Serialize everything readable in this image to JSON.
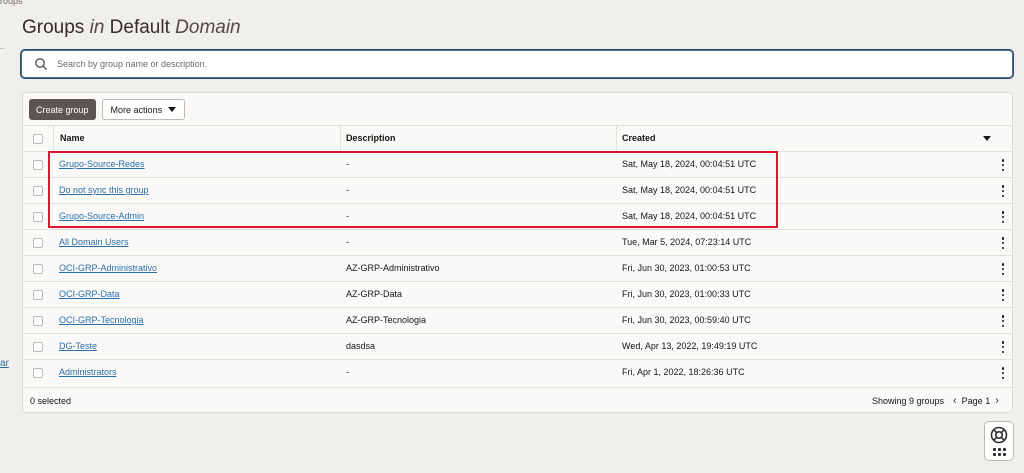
{
  "breadcrumb_fragment": "roups",
  "side_fragment": "ar",
  "header": {
    "title_part1": "Groups",
    "title_in": "in",
    "title_part2": "Default",
    "title_domain": "Domain"
  },
  "search": {
    "placeholder": "Search by group name or description.",
    "value": ""
  },
  "toolbar": {
    "create_label": "Create group",
    "more_label": "More actions"
  },
  "table": {
    "columns": {
      "name": "Name",
      "description": "Description",
      "created": "Created"
    },
    "rows": [
      {
        "name": "Grupo-Source-Redes",
        "description": "-",
        "created": "Sat, May 18, 2024, 00:04:51 UTC"
      },
      {
        "name": "Do not sync this group",
        "description": "-",
        "created": "Sat, May 18, 2024, 00:04:51 UTC"
      },
      {
        "name": "Grupo-Source-Admin",
        "description": "-",
        "created": "Sat, May 18, 2024, 00:04:51 UTC"
      },
      {
        "name": "All Domain Users",
        "description": "-",
        "created": "Tue, Mar 5, 2024, 07:23:14 UTC"
      },
      {
        "name": "OCI-GRP-Administrativo",
        "description": "AZ-GRP-Administrativo",
        "created": "Fri, Jun 30, 2023, 01:00:53 UTC"
      },
      {
        "name": "OCI-GRP-Data",
        "description": "AZ-GRP-Data",
        "created": "Fri, Jun 30, 2023, 01:00:33 UTC"
      },
      {
        "name": "OCI-GRP-Tecnologia",
        "description": "AZ-GRP-Tecnologia",
        "created": "Fri, Jun 30, 2023, 00:59:40 UTC"
      },
      {
        "name": "DG-Teste",
        "description": "dasdsa",
        "created": "Wed, Apr 13, 2022, 19:49:19 UTC"
      },
      {
        "name": "Administrators",
        "description": "-",
        "created": "Fri, Apr 1, 2022, 18:26:36 UTC"
      }
    ]
  },
  "footer": {
    "selected": "0 selected",
    "showing": "Showing 9 groups",
    "page": "Page 1"
  },
  "colors": {
    "accent_border": "#1f4f67",
    "link": "#2a6fa8",
    "highlight": "#e0142a",
    "primary_button": "#5b5652"
  },
  "icons": [
    "search-icon",
    "caret-down-icon",
    "kebab-menu-icon",
    "chevron-left-icon",
    "chevron-right-icon",
    "help-lifebuoy-icon",
    "grid-apps-icon"
  ]
}
